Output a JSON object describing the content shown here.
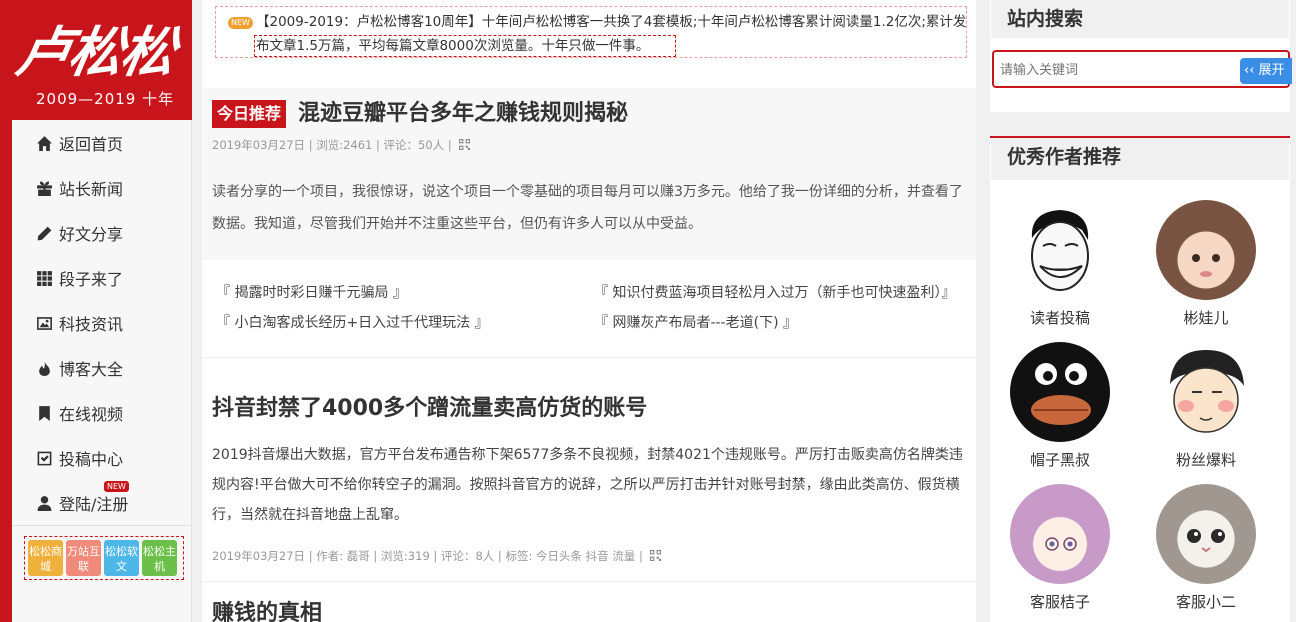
{
  "logo": {
    "brand": "卢松松",
    "years": "2009—2019  十年"
  },
  "nav": {
    "items": [
      {
        "label": "返回首页",
        "icon": "home-icon"
      },
      {
        "label": "站长新闻",
        "icon": "gift-icon"
      },
      {
        "label": "好文分享",
        "icon": "pencil-icon"
      },
      {
        "label": "段子来了",
        "icon": "grid-icon"
      },
      {
        "label": "科技资讯",
        "icon": "image-icon"
      },
      {
        "label": "博客大全",
        "icon": "fire-icon"
      },
      {
        "label": "在线视频",
        "icon": "bookmark-icon"
      },
      {
        "label": "投稿中心",
        "icon": "check-square-icon"
      },
      {
        "label": "登陆/注册",
        "icon": "user-icon",
        "badge": "NEW"
      }
    ]
  },
  "tiles": [
    {
      "label": "松松商城",
      "color": "#f0b03c"
    },
    {
      "label": "万站互联",
      "color": "#f08a7a"
    },
    {
      "label": "松松软文",
      "color": "#4db8e8"
    },
    {
      "label": "松松主机",
      "color": "#6cc04a"
    }
  ],
  "notice": {
    "badge": "NEW",
    "text": "【2009-2019：卢松松博客10周年】十年间卢松松博客一共换了4套模板;十年间卢松松博客累计阅读量1.2亿次;累计发布文章1.5万篇，平均每篇文章8000次浏览量。十年只做一件事。"
  },
  "featured": {
    "tag": "今日推荐",
    "title": "混迹豆瓣平台多年之赚钱规则揭秘",
    "meta": "2019年03月27日 | 浏览:2461 | 评论：50人 |",
    "excerpt": "读者分享的一个项目，我很惊讶，说这个项目一个零基础的项目每月可以赚3万多元。他给了我一份详细的分析，并查看了数据。我知道，尽管我们开始并不注重这些平台，但仍有许多人可以从中受益。"
  },
  "related": [
    "『 揭露时时彩日赚千元骗局 』",
    "『 知识付费蓝海项目轻松月入过万（新手也可快速盈利）』",
    "『 小白淘客成长经历+日入过千代理玩法 』",
    "『 网赚灰产布局者---老道(下) 』"
  ],
  "posts": [
    {
      "title": "抖音封禁了4000多个蹭流量卖高仿货的账号",
      "excerpt": "2019抖音爆出大数据，官方平台发布通告称下架6577多条不良视频，封禁4021个违规账号。严厉打击贩卖高仿名牌类违规内容!平台做大可不给你转空子的漏洞。按照抖音官方的说辞，之所以严厉打击并针对账号封禁，缘由此类高仿、假货横行，当然就在抖音地盘上乱窜。",
      "meta": "2019年03月27日 | 作者: 磊哥 | 浏览:319 | 评论：8人 | 标签: 今日头条 抖音 流量 |"
    },
    {
      "title": "赚钱的真相"
    }
  ],
  "search": {
    "heading": "站内搜索",
    "placeholder": "请输入关键词",
    "button": "展开"
  },
  "authors": {
    "heading": "优秀作者推荐",
    "items": [
      {
        "name": "读者投稿"
      },
      {
        "name": "彬娃儿"
      },
      {
        "name": "帽子黑叔"
      },
      {
        "name": "粉丝爆料"
      },
      {
        "name": "客服桔子"
      },
      {
        "name": "客服小二"
      }
    ]
  },
  "colors": {
    "brand_red": "#c8151b",
    "search_blue": "#3b8ee6"
  }
}
